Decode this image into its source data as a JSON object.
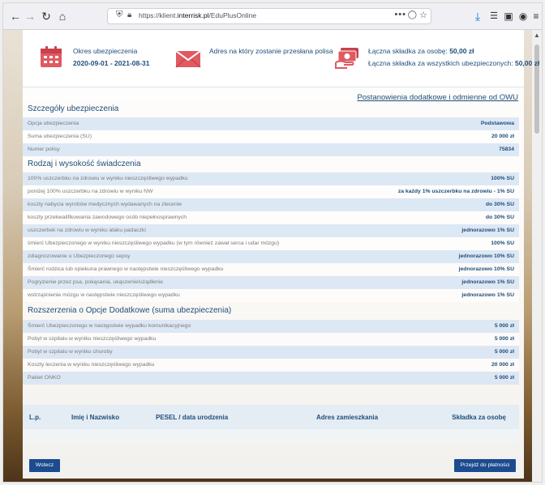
{
  "browser": {
    "url_prefix": "https://klient.",
    "url_domain": "interrisk.pl",
    "url_path": "/EduPlusOnline",
    "icons": [
      "back-icon",
      "forward-icon",
      "reload-icon",
      "home-icon",
      "shield-icon",
      "lock-icon",
      "more-icon",
      "pocket-icon",
      "star-icon",
      "download-icon",
      "library-icon",
      "sidebar-icon",
      "account-icon",
      "menu-icon"
    ]
  },
  "summary": {
    "period_label": "Okres ubezpieczenia",
    "period_value": "2020-09-01 - 2021-08-31",
    "address_label": "Adres na który zostanie przesłana polisa",
    "premium_per_person_label": "Łączna składka za osobę:",
    "premium_per_person_value": "50,00 zł",
    "premium_total_label": "Łączna składka za wszystkich ubezpieczonych:",
    "premium_total_value": "50,00 zł"
  },
  "link_text": "Postanowienia dodatkowe i odmienne od OWU",
  "sections": {
    "details_title": "Szczegóły ubezpieczenia",
    "details": [
      {
        "label": "Opcja ubezpieczenia",
        "value": "Podstawowa"
      },
      {
        "label": "Suma ubezpieczenia (SU)",
        "value": "20 000 zł"
      },
      {
        "label": "Numer polisy",
        "value": "75834"
      }
    ],
    "benefits_title": "Rodzaj i wysokość świadczenia",
    "benefits": [
      {
        "label": "100% uszczerbku na zdrowiu w wyniku nieszczęśliwego wypadku",
        "value": "100% SU"
      },
      {
        "label": "poniżej 100% uszczerbku na zdrowiu w wyniku NW",
        "value": "za każdy 1% uszczerbku na zdrowiu - 1% SU"
      },
      {
        "label": "koszty nabycia wyrobów medycznych wydawanych na zlecenie",
        "value": "do 30% SU"
      },
      {
        "label": "koszty przekwalifikowania zawodowego osób niepełnosprawnych",
        "value": "do 30% SU"
      },
      {
        "label": "uszczerbek na zdrowiu w wyniku ataku padaczki",
        "value": "jednorazowo 1% SU"
      },
      {
        "label": "śmierć Ubezpieczonego w wyniku nieszczęśliwego wypadku (w tym również zawał serca i udar mózgu)",
        "value": "100% SU"
      },
      {
        "label": "zdiagnozowanie u Ubezpieczonego sepsy",
        "value": "jednorazowo 10% SU"
      },
      {
        "label": "Śmierć rodzica lub opiekuna prawnego w następstwie nieszczęśliwego wypadku",
        "value": "jednorazowo 10% SU"
      },
      {
        "label": "Pogryzienie przez psa, pokąsania, ukąszenie/użądlenie",
        "value": "jednorazowo 1% SU"
      },
      {
        "label": "wstrząśnienie mózgu w następstwie nieszczęśliwego wypadku",
        "value": "jednorazowo 1% SU"
      }
    ],
    "extensions_title": "Rozszerzenia o Opcje Dodatkowe (suma ubezpieczenia)",
    "extensions": [
      {
        "label": "Śmierć Ubezpieczonego w następstwie wypadku komunikacyjnego",
        "value": "5 000 zł"
      },
      {
        "label": "Pobyt w szpitalu w wyniku nieszczęśliwego wypadku",
        "value": "5 000 zł"
      },
      {
        "label": "Pobyt w szpitalu w wyniku choroby",
        "value": "5 000 zł"
      },
      {
        "label": "Koszty leczenia w wyniku nieszczęśliwego wypadku",
        "value": "20 000 zł"
      },
      {
        "label": "Pakiet ONKO",
        "value": "5 000 zł"
      }
    ]
  },
  "table": {
    "headers": [
      "L.p.",
      "Imię i Nazwisko",
      "PESEL / data urodzenia",
      "Adres zamieszkania",
      "Składka za osobę"
    ]
  },
  "buttons": {
    "back": "Wstecz",
    "pay": "Przejdź do płatności"
  },
  "colors": {
    "accent": "#1c4b8f",
    "heading": "#1f4e79",
    "row_alt": "#d9e6f4",
    "icon_red": "#e05a62"
  }
}
